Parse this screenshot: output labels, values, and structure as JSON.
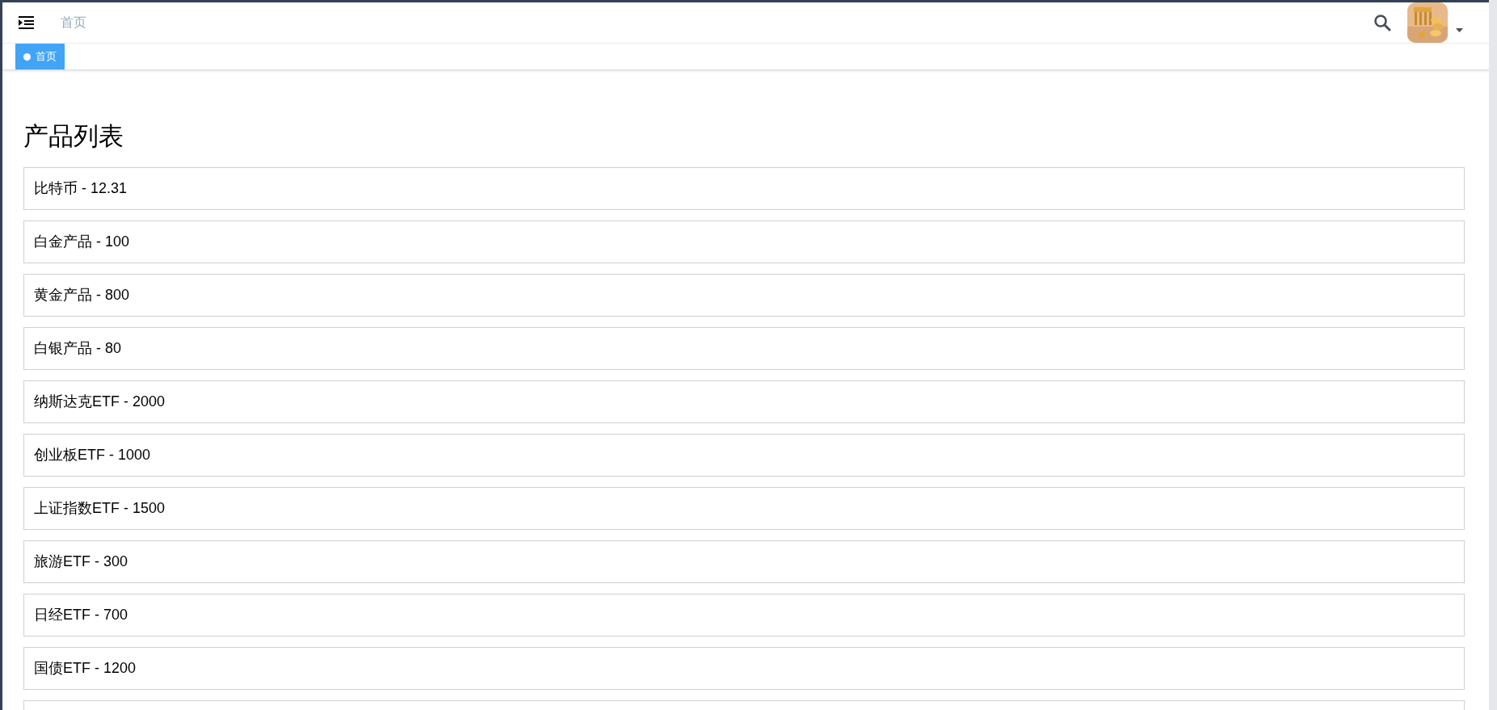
{
  "header": {
    "breadcrumb": "首页"
  },
  "tags": [
    {
      "label": "首页",
      "selected": true
    }
  ],
  "page": {
    "title": "产品列表",
    "products": [
      {
        "label": "比特币 - 12.31"
      },
      {
        "label": "白金产品 - 100"
      },
      {
        "label": "黄金产品 - 800"
      },
      {
        "label": "白银产品 - 80"
      },
      {
        "label": "纳斯达克ETF - 2000"
      },
      {
        "label": "创业板ETF - 1000"
      },
      {
        "label": "上证指数ETF - 1500"
      },
      {
        "label": "旅游ETF - 300"
      },
      {
        "label": "日经ETF - 700"
      },
      {
        "label": "国债ETF - 1200"
      }
    ]
  }
}
